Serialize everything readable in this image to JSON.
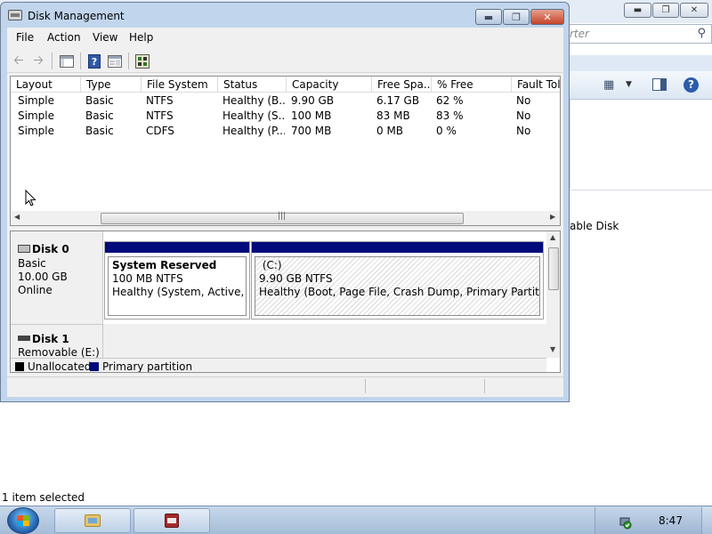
{
  "background_window": {
    "search_placeholder": "rter",
    "device_label": "able Disk",
    "status_text": "1 item selected"
  },
  "window": {
    "title": "Disk Management",
    "menu": [
      "File",
      "Action",
      "View",
      "Help"
    ]
  },
  "volume_list": {
    "columns": [
      "Layout",
      "Type",
      "File System",
      "Status",
      "Capacity",
      "Free Spa...",
      "% Free",
      "Fault Tole"
    ],
    "rows": [
      [
        "Simple",
        "Basic",
        "NTFS",
        "Healthy (B...",
        "9.90 GB",
        "6.17 GB",
        "62 %",
        "No"
      ],
      [
        "Simple",
        "Basic",
        "NTFS",
        "Healthy (S...",
        "100 MB",
        "83 MB",
        "83 %",
        "No"
      ],
      [
        "Simple",
        "Basic",
        "CDFS",
        "Healthy (P...",
        "700 MB",
        "0 MB",
        "0 %",
        "No"
      ]
    ]
  },
  "disks": [
    {
      "name": "Disk 0",
      "type": "Basic",
      "size": "10.00 GB",
      "state": "Online",
      "partitions": [
        {
          "name": "System Reserved",
          "size_fs": "100 MB NTFS",
          "status": "Healthy (System, Active, Prir"
        },
        {
          "name": "(C:)",
          "size_fs": "9.90 GB NTFS",
          "status": "Healthy (Boot, Page File, Crash Dump, Primary Partition)"
        }
      ]
    },
    {
      "name": "Disk 1",
      "type": "Removable (E:)"
    }
  ],
  "legend": {
    "unallocated": "Unallocated",
    "primary": "Primary partition",
    "unallocated_color": "#000000",
    "primary_color": "#000a7a"
  },
  "taskbar": {
    "clock": "8:47"
  },
  "icons": [
    "back-arrow-icon",
    "forward-arrow-icon",
    "console-tree-icon",
    "help-book-icon",
    "properties-icon",
    "settings-icon",
    "search-icon",
    "help-icon",
    "disk-icon",
    "removable-disk-icon",
    "start-icon",
    "explorer-icon",
    "disk-management-icon",
    "usb-safely-remove-icon"
  ]
}
